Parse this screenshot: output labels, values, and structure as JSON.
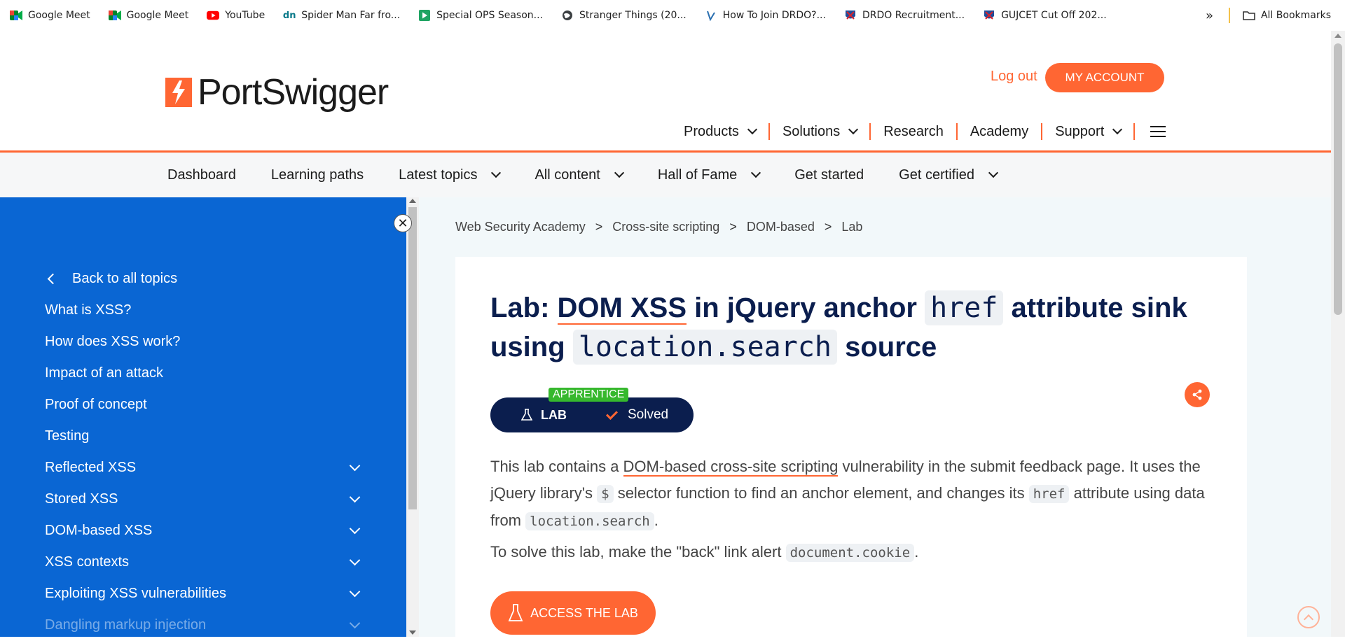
{
  "bookmarks": {
    "items": [
      {
        "label": "Google Meet",
        "icon": "google-meet-icon"
      },
      {
        "label": "Google Meet",
        "icon": "google-meet-icon"
      },
      {
        "label": "YouTube",
        "icon": "youtube-icon"
      },
      {
        "label": "Spider Man Far fro...",
        "icon": "site-icon"
      },
      {
        "label": "Special OPS Season...",
        "icon": "play-icon"
      },
      {
        "label": "Stranger Things (20...",
        "icon": "globe-icon"
      },
      {
        "label": "How To Join DRDO?...",
        "icon": "site-icon"
      },
      {
        "label": "DRDO Recruitment...",
        "icon": "shield-icon"
      },
      {
        "label": "GUJCET Cut Off 202...",
        "icon": "shield-icon"
      }
    ],
    "more": "»",
    "all_bookmarks": "All Bookmarks"
  },
  "header": {
    "brand": "PortSwigger",
    "logout": "Log out",
    "my_account": "MY ACCOUNT",
    "nav": [
      "Products",
      "Solutions",
      "Research",
      "Academy",
      "Support"
    ]
  },
  "subnav": [
    "Dashboard",
    "Learning paths",
    "Latest topics",
    "All content",
    "Hall of Fame",
    "Get started",
    "Get certified"
  ],
  "sidebar": {
    "close": "✕",
    "back": "Back to all topics",
    "items": [
      {
        "label": "What is XSS?"
      },
      {
        "label": "How does XSS work?"
      },
      {
        "label": "Impact of an attack"
      },
      {
        "label": "Proof of concept"
      },
      {
        "label": "Testing"
      },
      {
        "label": "Reflected XSS"
      },
      {
        "label": "Stored XSS"
      },
      {
        "label": "DOM-based XSS"
      },
      {
        "label": "XSS contexts"
      },
      {
        "label": "Exploiting XSS vulnerabilities"
      },
      {
        "label": "Dangling markup injection"
      }
    ]
  },
  "breadcrumb": [
    "Web Security Academy",
    "Cross-site scripting",
    "DOM-based",
    "Lab"
  ],
  "lab": {
    "title_prefix": "Lab: ",
    "title_link": "DOM XSS",
    "title_mid": " in jQuery anchor ",
    "title_code1": "href",
    "title_mid2": " attribute sink using ",
    "title_code2": "location.search",
    "title_end": " source",
    "level": "APPRENTICE",
    "badge_lab": "LAB",
    "badge_status": "Solved",
    "desc1_a": "This lab contains a ",
    "desc1_link": "DOM-based cross-site scripting",
    "desc1_b": " vulnerability in the submit feedback page. It uses the jQuery library's ",
    "desc1_code1": "$",
    "desc1_c": " selector function to find an anchor element, and changes its ",
    "desc1_code2": "href",
    "desc1_d": " attribute using data from ",
    "desc1_code3": "location.search",
    "desc1_e": ".",
    "desc2_a": "To solve this lab, make the \"back\" link alert ",
    "desc2_code": "document.cookie",
    "desc2_b": ".",
    "access": "ACCESS THE LAB"
  },
  "colors": {
    "accent": "#ff6633",
    "sidebar": "#0a66d3",
    "title": "#0b1e4e",
    "level": "#36b82d"
  }
}
